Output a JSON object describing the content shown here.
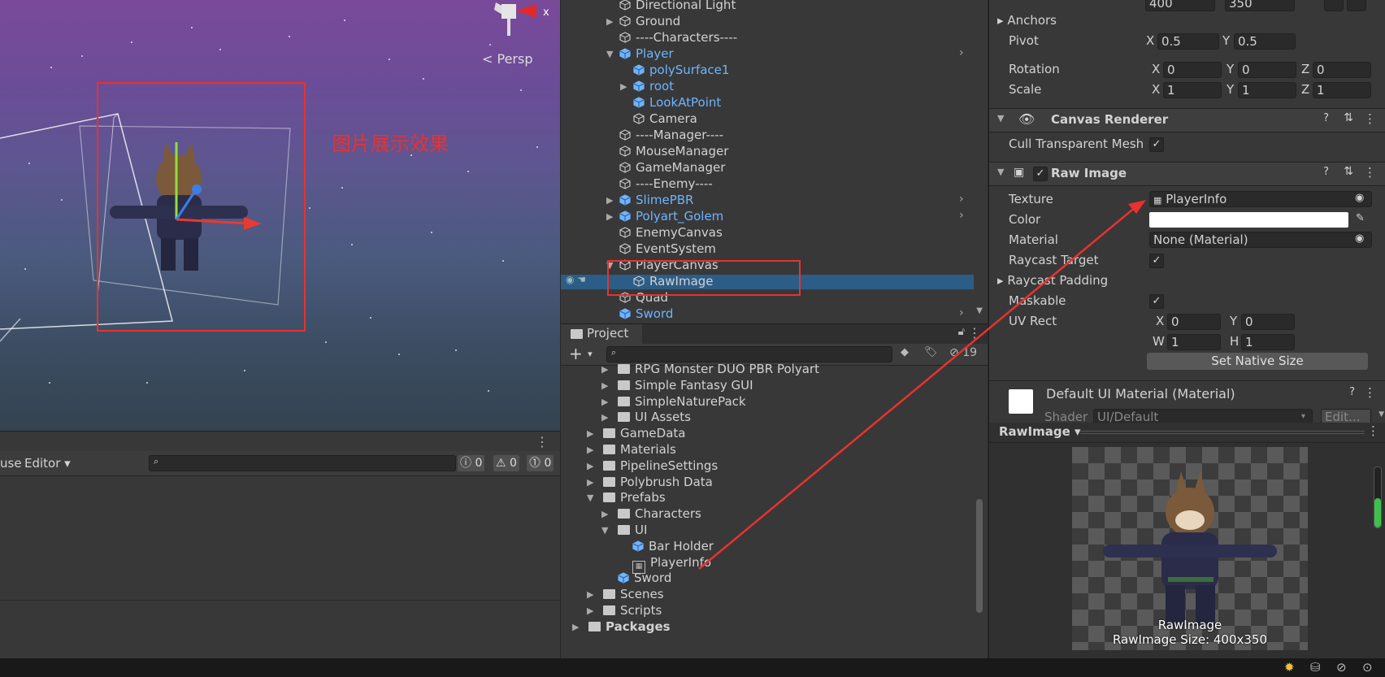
{
  "scene": {
    "view_mode": "Persp",
    "axis_label": "x",
    "annotation": "图片展示效果"
  },
  "console": {
    "tab_partial": "use",
    "editor_label": "Editor",
    "search_placeholder": "",
    "counts": [
      "0",
      "0",
      "0"
    ]
  },
  "hierarchy": {
    "items": [
      {
        "label": "Directional Light",
        "indent": 0,
        "blue": false
      },
      {
        "label": "Ground",
        "indent": 0,
        "blue": false,
        "fold": "▶"
      },
      {
        "label": "----Characters----",
        "indent": 0,
        "blue": false
      },
      {
        "label": "Player",
        "indent": 0,
        "blue": true,
        "fold": "▼",
        "more": true
      },
      {
        "label": "polySurface1",
        "indent": 1,
        "blue": true
      },
      {
        "label": "root",
        "indent": 1,
        "blue": true,
        "fold": "▶"
      },
      {
        "label": "LookAtPoint",
        "indent": 1,
        "blue": true
      },
      {
        "label": "Camera",
        "indent": 1,
        "blue": false
      },
      {
        "label": "----Manager----",
        "indent": 0,
        "blue": false
      },
      {
        "label": "MouseManager",
        "indent": 0,
        "blue": false
      },
      {
        "label": "GameManager",
        "indent": 0,
        "blue": false
      },
      {
        "label": "----Enemy----",
        "indent": 0,
        "blue": false
      },
      {
        "label": "SlimePBR",
        "indent": 0,
        "blue": true,
        "fold": "▶",
        "more": true
      },
      {
        "label": "Polyart_Golem",
        "indent": 0,
        "blue": true,
        "fold": "▶",
        "more": true
      },
      {
        "label": "EnemyCanvas",
        "indent": 0,
        "blue": false
      },
      {
        "label": "EventSystem",
        "indent": 0,
        "blue": false
      },
      {
        "label": "PlayerCanvas",
        "indent": 0,
        "blue": false,
        "fold": "▼"
      },
      {
        "label": "RawImage",
        "indent": 1,
        "blue": false,
        "selected": true
      },
      {
        "label": "Quad",
        "indent": 0,
        "blue": false
      },
      {
        "label": "Sword",
        "indent": 0,
        "blue": true,
        "more": true
      }
    ]
  },
  "project": {
    "tab": "Project",
    "badge_count": "19",
    "items": [
      {
        "label": "RPG Monster DUO PBR Polyart",
        "indent": 1,
        "fold": "▶",
        "type": "folder"
      },
      {
        "label": "Simple Fantasy GUI",
        "indent": 1,
        "fold": "▶",
        "type": "folder"
      },
      {
        "label": "SimpleNaturePack",
        "indent": 1,
        "fold": "▶",
        "type": "folder"
      },
      {
        "label": "UI Assets",
        "indent": 1,
        "fold": "▶",
        "type": "folder"
      },
      {
        "label": "GameData",
        "indent": 0,
        "fold": "▶",
        "type": "folder"
      },
      {
        "label": "Materials",
        "indent": 0,
        "fold": "▶",
        "type": "folder"
      },
      {
        "label": "PipelineSettings",
        "indent": 0,
        "fold": "▶",
        "type": "folder"
      },
      {
        "label": "Polybrush Data",
        "indent": 0,
        "fold": "▶",
        "type": "folder"
      },
      {
        "label": "Prefabs",
        "indent": 0,
        "fold": "▼",
        "type": "folder"
      },
      {
        "label": "Characters",
        "indent": 1,
        "fold": "▶",
        "type": "folder"
      },
      {
        "label": "UI",
        "indent": 1,
        "fold": "▼",
        "type": "folder"
      },
      {
        "label": "Bar Holder",
        "indent": 2,
        "type": "prefab"
      },
      {
        "label": "PlayerInfo",
        "indent": 2,
        "type": "texture"
      },
      {
        "label": "Sword",
        "indent": 1,
        "type": "prefab"
      },
      {
        "label": "Scenes",
        "indent": 0,
        "fold": "▶",
        "type": "folder"
      },
      {
        "label": "Scripts",
        "indent": 0,
        "fold": "▶",
        "type": "folder"
      },
      {
        "label": "Packages",
        "indent": -1,
        "fold": "▶",
        "type": "folder",
        "bold": true
      }
    ]
  },
  "inspector": {
    "top_vals": [
      "400",
      "350"
    ],
    "anchors": "Anchors",
    "pivot": {
      "label": "Pivot",
      "x": "0.5",
      "y": "0.5"
    },
    "rotation": {
      "label": "Rotation",
      "x": "0",
      "y": "0",
      "z": "0"
    },
    "scale": {
      "label": "Scale",
      "x": "1",
      "y": "1",
      "z": "1"
    },
    "axis": {
      "x": "X",
      "y": "Y",
      "z": "Z",
      "w": "W",
      "h": "H"
    },
    "canvas_renderer": {
      "title": "Canvas Renderer",
      "cull": "Cull Transparent Mesh"
    },
    "raw_image": {
      "title": "Raw Image",
      "texture_label": "Texture",
      "texture": "PlayerInfo",
      "color_label": "Color",
      "material_label": "Material",
      "material": "None (Material)",
      "raycast_target": "Raycast Target",
      "raycast_padding": "Raycast Padding",
      "maskable": "Maskable",
      "uv_rect": "UV Rect",
      "uv": {
        "x": "0",
        "y": "0",
        "w": "1",
        "h": "1"
      },
      "native_size": "Set Native Size"
    },
    "material": {
      "title": "Default UI Material (Material)",
      "shader_label": "Shader",
      "shader": "UI/Default",
      "edit": "Edit..."
    }
  },
  "preview": {
    "name": "RawImage",
    "caption": "RawImage",
    "size": "RawImage Size: 400x350"
  }
}
